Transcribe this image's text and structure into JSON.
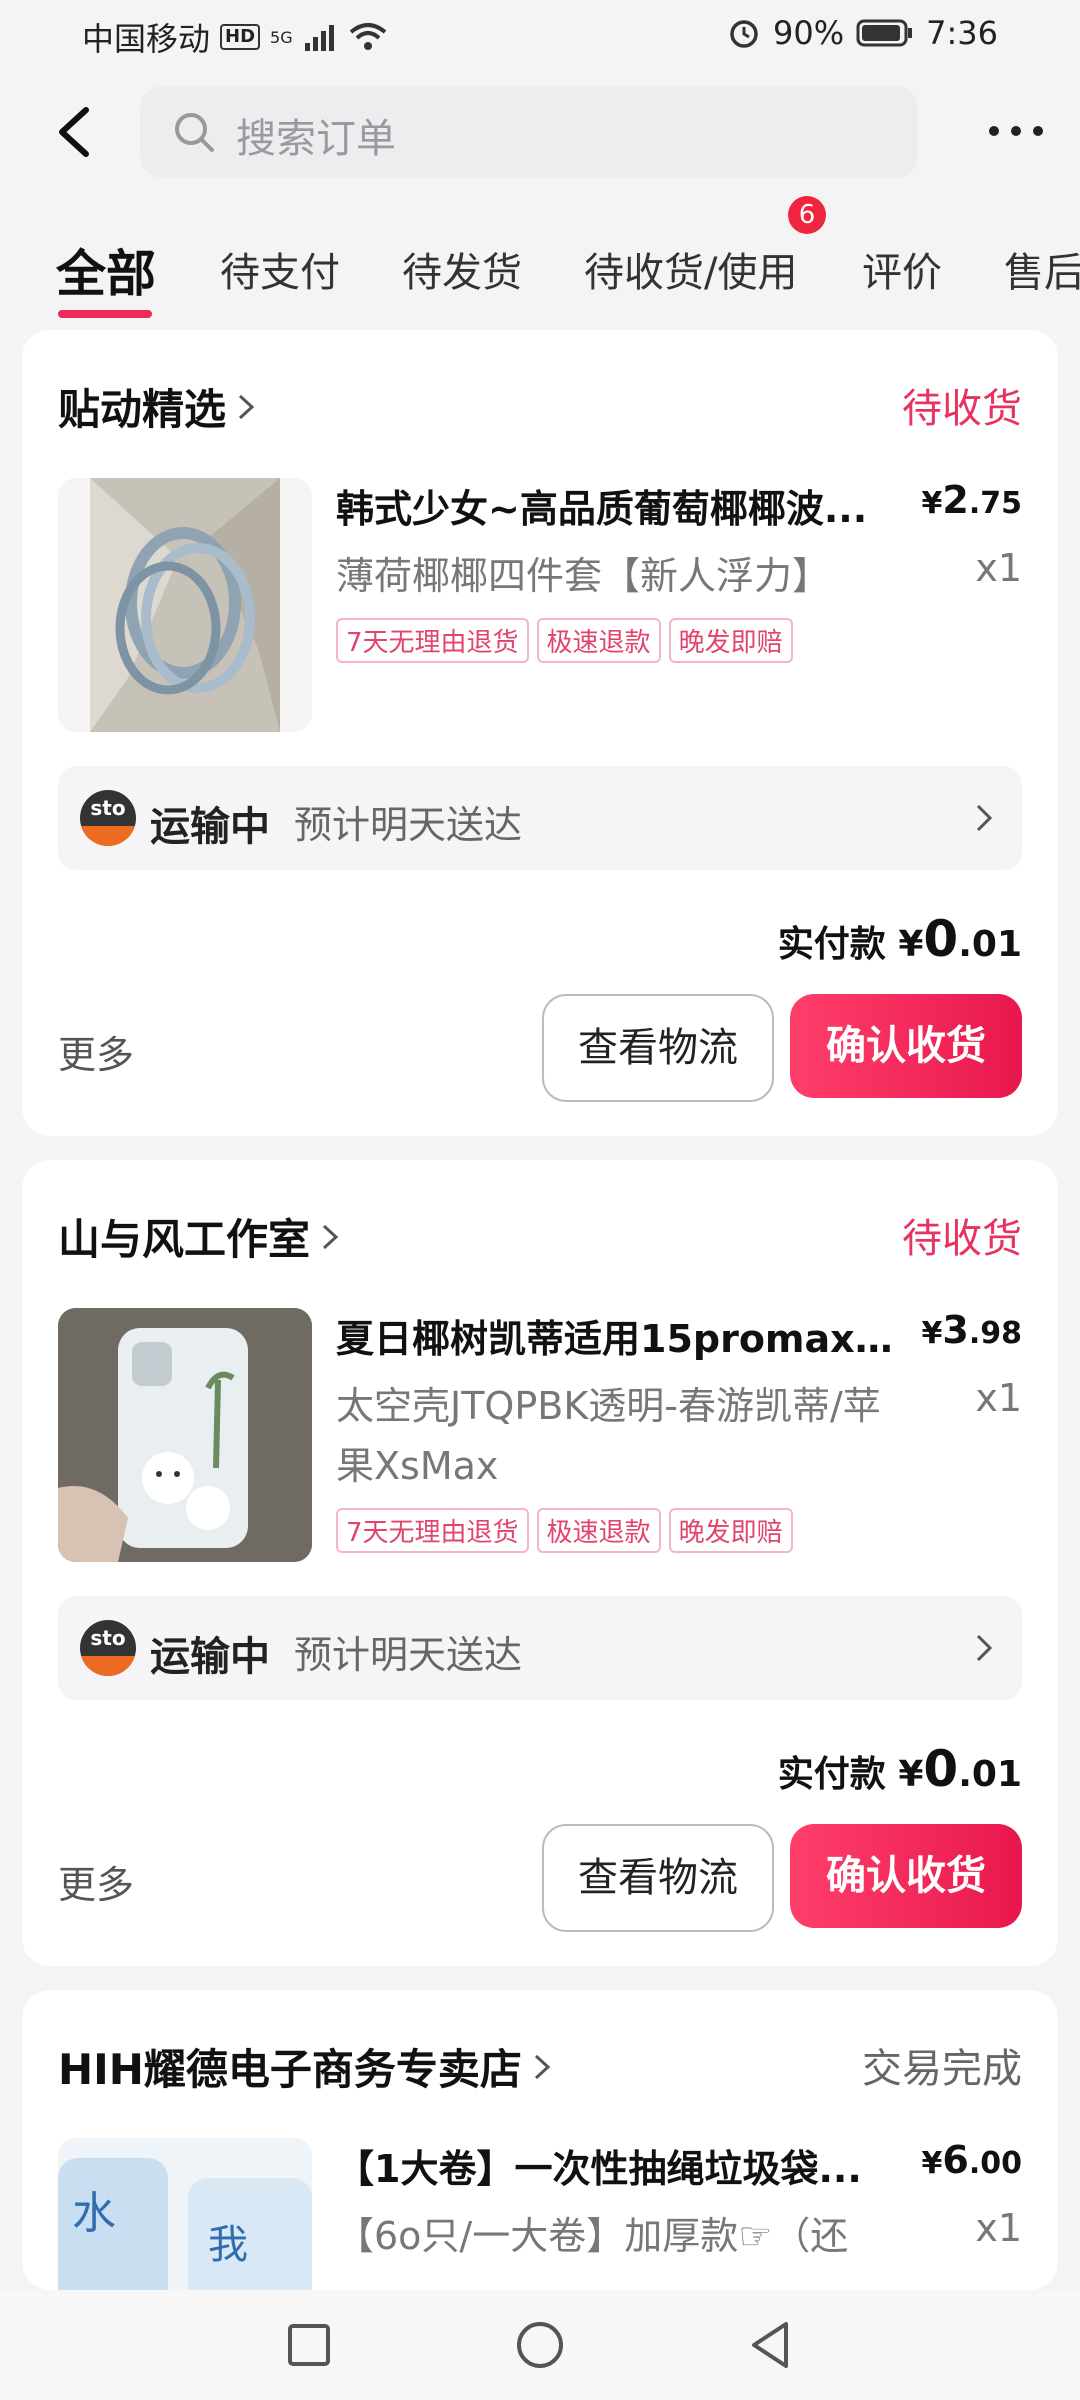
{
  "status_bar": {
    "carrier": "中国移动",
    "hd": "HD",
    "signal": "5G",
    "battery": "90%",
    "time": "7:36"
  },
  "search": {
    "placeholder": "搜索订单"
  },
  "tabs": [
    {
      "label": "全部"
    },
    {
      "label": "待支付"
    },
    {
      "label": "待发货"
    },
    {
      "label": "待收货/使用",
      "badge": "6"
    },
    {
      "label": "评价"
    },
    {
      "label": "售后"
    }
  ],
  "orders": [
    {
      "store": "贴动精选",
      "status": "待收货",
      "product_name": "韩式少女~高品质葡萄椰椰波...",
      "price_symbol": "¥",
      "price_int": "2",
      "price_dec": ".75",
      "spec": "薄荷椰椰四件套【新人浮力】",
      "qty": "x1",
      "tags": [
        "7天无理由退货",
        "极速退款",
        "晚发即赔"
      ],
      "shipping": {
        "logo": "sto",
        "status": "运输中",
        "eta": "预计明天送达"
      },
      "paid_label": "实付款",
      "paid_symbol": "¥",
      "paid_int": "0",
      "paid_dec": ".01",
      "more": "更多",
      "btn_logistics": "查看物流",
      "btn_confirm": "确认收货"
    },
    {
      "store": "山与风工作室",
      "status": "待收货",
      "product_name": "夏日椰树凯蒂适用15promax...",
      "price_symbol": "¥",
      "price_int": "3",
      "price_dec": ".98",
      "spec": "太空壳JTQPBK透明-春游凯蒂/苹果XsMax",
      "qty": "x1",
      "tags": [
        "7天无理由退货",
        "极速退款",
        "晚发即赔"
      ],
      "shipping": {
        "logo": "sto",
        "status": "运输中",
        "eta": "预计明天送达"
      },
      "paid_label": "实付款",
      "paid_symbol": "¥",
      "paid_int": "0",
      "paid_dec": ".01",
      "more": "更多",
      "btn_logistics": "查看物流",
      "btn_confirm": "确认收货"
    },
    {
      "store": "HIH耀德电子商务专卖店",
      "status": "交易完成",
      "product_name": "【1大卷】一次性抽绳垃圾袋...",
      "price_symbol": "¥",
      "price_int": "6",
      "price_dec": ".00",
      "spec": "【6o只/一大卷】加厚款☞（还",
      "qty": "x1"
    }
  ],
  "colors": {
    "accent": "#e6335f",
    "button_gradient_start": "#ff3f6b",
    "button_gradient_end": "#e8174d"
  },
  "icons": [
    "back-arrow-icon",
    "search-icon",
    "more-dots-icon",
    "chevron-right-icon",
    "sto-express-logo",
    "nav-square-icon",
    "nav-circle-icon",
    "nav-triangle-icon"
  ]
}
